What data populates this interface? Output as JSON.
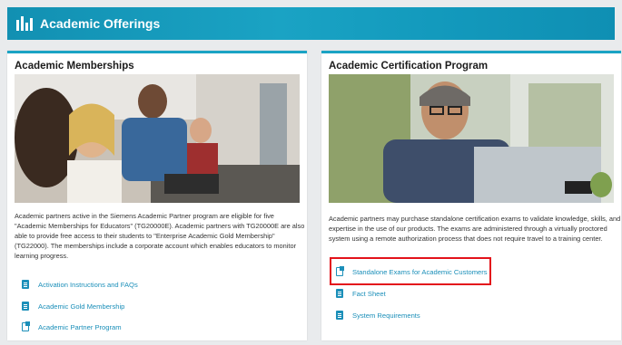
{
  "header": {
    "title": "Academic Offerings",
    "icon": "bar-chart-icon"
  },
  "memberships": {
    "title": "Academic Memberships",
    "description": "Academic partners active in the Siemens Academic Partner program are eligible for five \"Academic Memberships for Educators\" (TG20000E). Academic partners with TG20000E are also able to provide free access to their students to \"Enterprise Academic Gold Membership\" (TG22000). The memberships include a corporate account which enables educators to monitor learning progress.",
    "links": [
      {
        "label": "Activation Instructions and FAQs",
        "icon": "document-icon"
      },
      {
        "label": "Academic Gold Membership",
        "icon": "document-icon"
      },
      {
        "label": "Academic Partner Program",
        "icon": "external-link-icon"
      }
    ]
  },
  "certification": {
    "title": "Academic Certification Program",
    "description": "Academic partners may purchase standalone certification exams to validate knowledge, skills, and expertise in the use of our products. The exams are administered through a virtually proctored system using a remote authorization process that does not require travel to a training center.",
    "links": [
      {
        "label": "Standalone Exams for Academic Customers",
        "icon": "external-link-icon"
      },
      {
        "label": "Fact Sheet",
        "icon": "document-icon"
      },
      {
        "label": "System Requirements",
        "icon": "document-icon"
      }
    ]
  },
  "colors": {
    "accent": "#1aa3c4",
    "link": "#1b8fb9",
    "highlight": "#e3131b"
  }
}
